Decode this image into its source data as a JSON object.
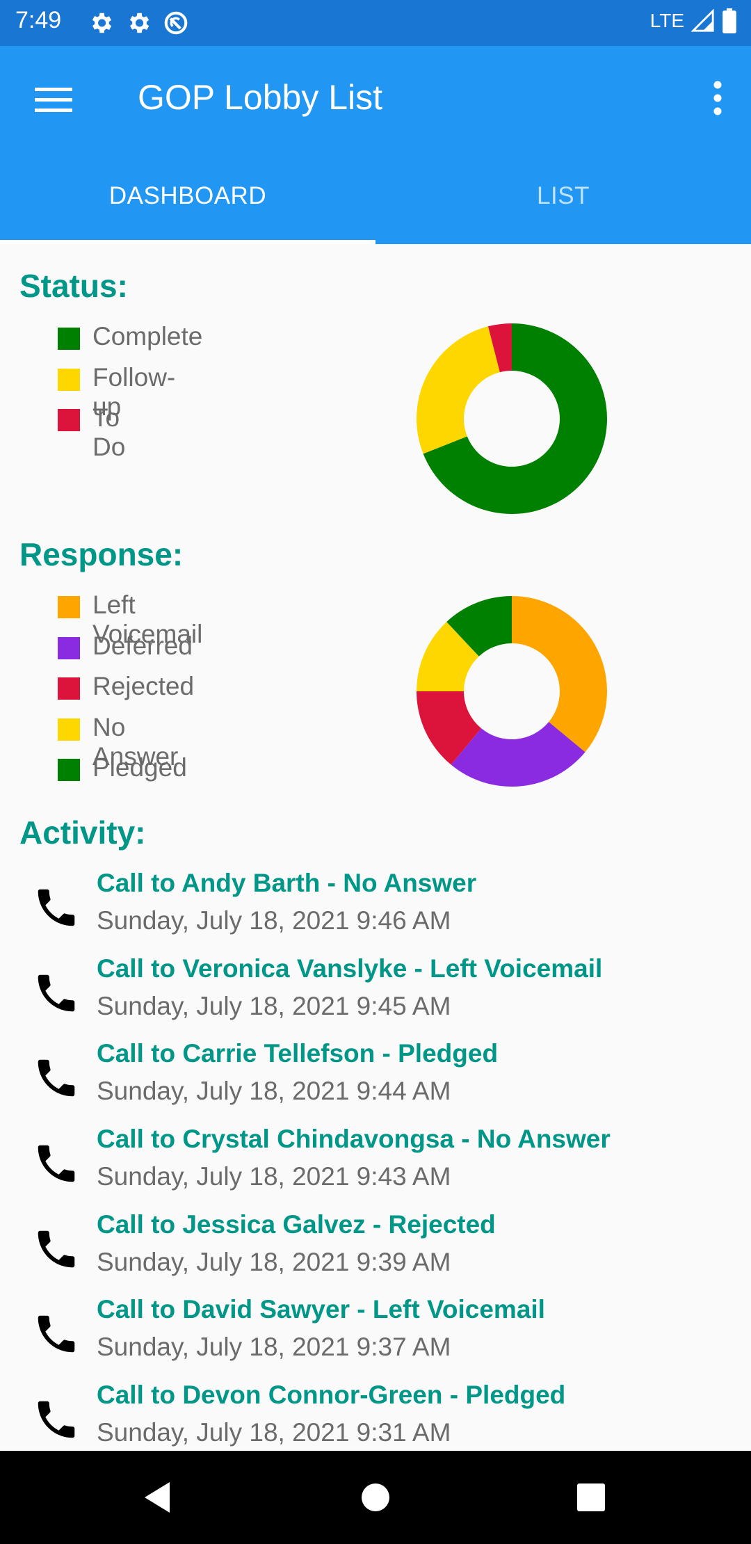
{
  "status_bar": {
    "time": "7:49",
    "network": "LTE",
    "icons": [
      "gear-icon",
      "gear-icon",
      "sync-icon",
      "signal-icon",
      "battery-icon"
    ]
  },
  "app_bar": {
    "title": "GOP Lobby List",
    "menu_icon": "menu-icon",
    "overflow_icon": "more-vert-icon",
    "background": "#2196f3"
  },
  "tabs": [
    {
      "label": "DASHBOARD",
      "selected": true
    },
    {
      "label": "LIST",
      "selected": false
    }
  ],
  "status_section": {
    "heading": "Status:",
    "legend": [
      {
        "label": "Complete",
        "color": "#008000"
      },
      {
        "label": "Follow-up",
        "color": "#ffd700"
      },
      {
        "label": "To Do",
        "color": "#dc143c"
      }
    ]
  },
  "response_section": {
    "heading": "Response:",
    "legend": [
      {
        "label": "Left Voicemail",
        "color": "#ffa500"
      },
      {
        "label": "Deferred",
        "color": "#8a2be2"
      },
      {
        "label": "Rejected",
        "color": "#dc143c"
      },
      {
        "label": "No Answer",
        "color": "#ffd700"
      },
      {
        "label": "Pledged",
        "color": "#008000"
      }
    ]
  },
  "chart_data": [
    {
      "type": "pie",
      "donut": true,
      "categories": [
        "Complete",
        "Follow-up",
        "To Do"
      ],
      "values": [
        69,
        27,
        4
      ],
      "colors": [
        "#008000",
        "#ffd700",
        "#dc143c"
      ]
    },
    {
      "type": "pie",
      "donut": true,
      "categories": [
        "Left Voicemail",
        "Deferred",
        "Rejected",
        "No Answer",
        "Pledged"
      ],
      "values": [
        36,
        25,
        14,
        13,
        12
      ],
      "colors": [
        "#ffa500",
        "#8a2be2",
        "#dc143c",
        "#ffd700",
        "#008000"
      ]
    }
  ],
  "activity_section": {
    "heading": "Activity:",
    "icon": "phone-icon",
    "items": [
      {
        "title": "Call to Andy Barth - No Answer",
        "time": "Sunday, July 18, 2021 9:46 AM"
      },
      {
        "title": "Call to Veronica Vanslyke - Left Voicemail",
        "time": "Sunday, July 18, 2021 9:45 AM"
      },
      {
        "title": "Call to Carrie Tellefson - Pledged",
        "time": "Sunday, July 18, 2021 9:44 AM"
      },
      {
        "title": "Call to Crystal Chindavongsa - No Answer",
        "time": "Sunday, July 18, 2021 9:43 AM"
      },
      {
        "title": "Call to Jessica Galvez - Rejected",
        "time": "Sunday, July 18, 2021 9:39 AM"
      },
      {
        "title": "Call to David Sawyer - Left Voicemail",
        "time": "Sunday, July 18, 2021 9:37 AM"
      },
      {
        "title": "Call to Devon Connor-Green - Pledged",
        "time": "Sunday, July 18, 2021 9:31 AM"
      }
    ]
  },
  "nav_bar": {
    "buttons": [
      "back-icon",
      "home-icon",
      "recents-icon"
    ]
  }
}
